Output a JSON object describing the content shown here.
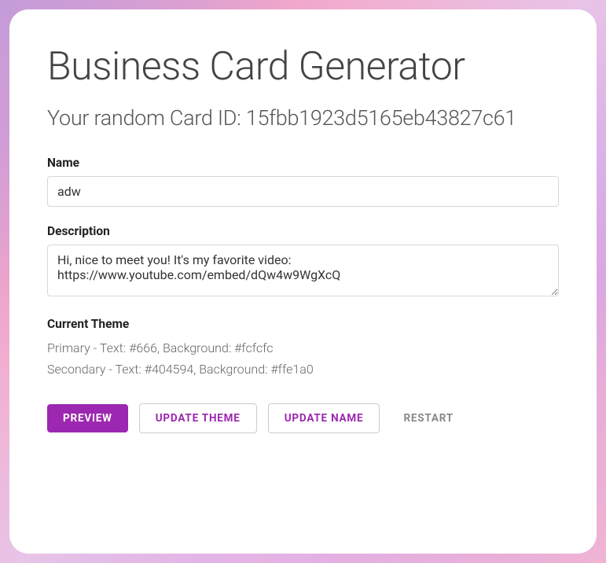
{
  "header": {
    "title": "Business Card Generator",
    "card_id_prefix": "Your random Card ID: ",
    "card_id": "15fbb1923d5165eb43827c61"
  },
  "form": {
    "name_label": "Name",
    "name_value": "adw",
    "description_label": "Description",
    "description_value": "Hi, nice to meet you! It's my favorite video: https://www.youtube.com/embed/dQw4w9WgXcQ"
  },
  "theme": {
    "label": "Current Theme",
    "primary_line": "Primary - Text: #666, Background: #fcfcfc",
    "secondary_line": "Secondary - Text: #404594, Background: #ffe1a0"
  },
  "buttons": {
    "preview": "PREVIEW",
    "update_theme": "UPDATE THEME",
    "update_name": "UPDATE NAME",
    "restart": "RESTART"
  }
}
